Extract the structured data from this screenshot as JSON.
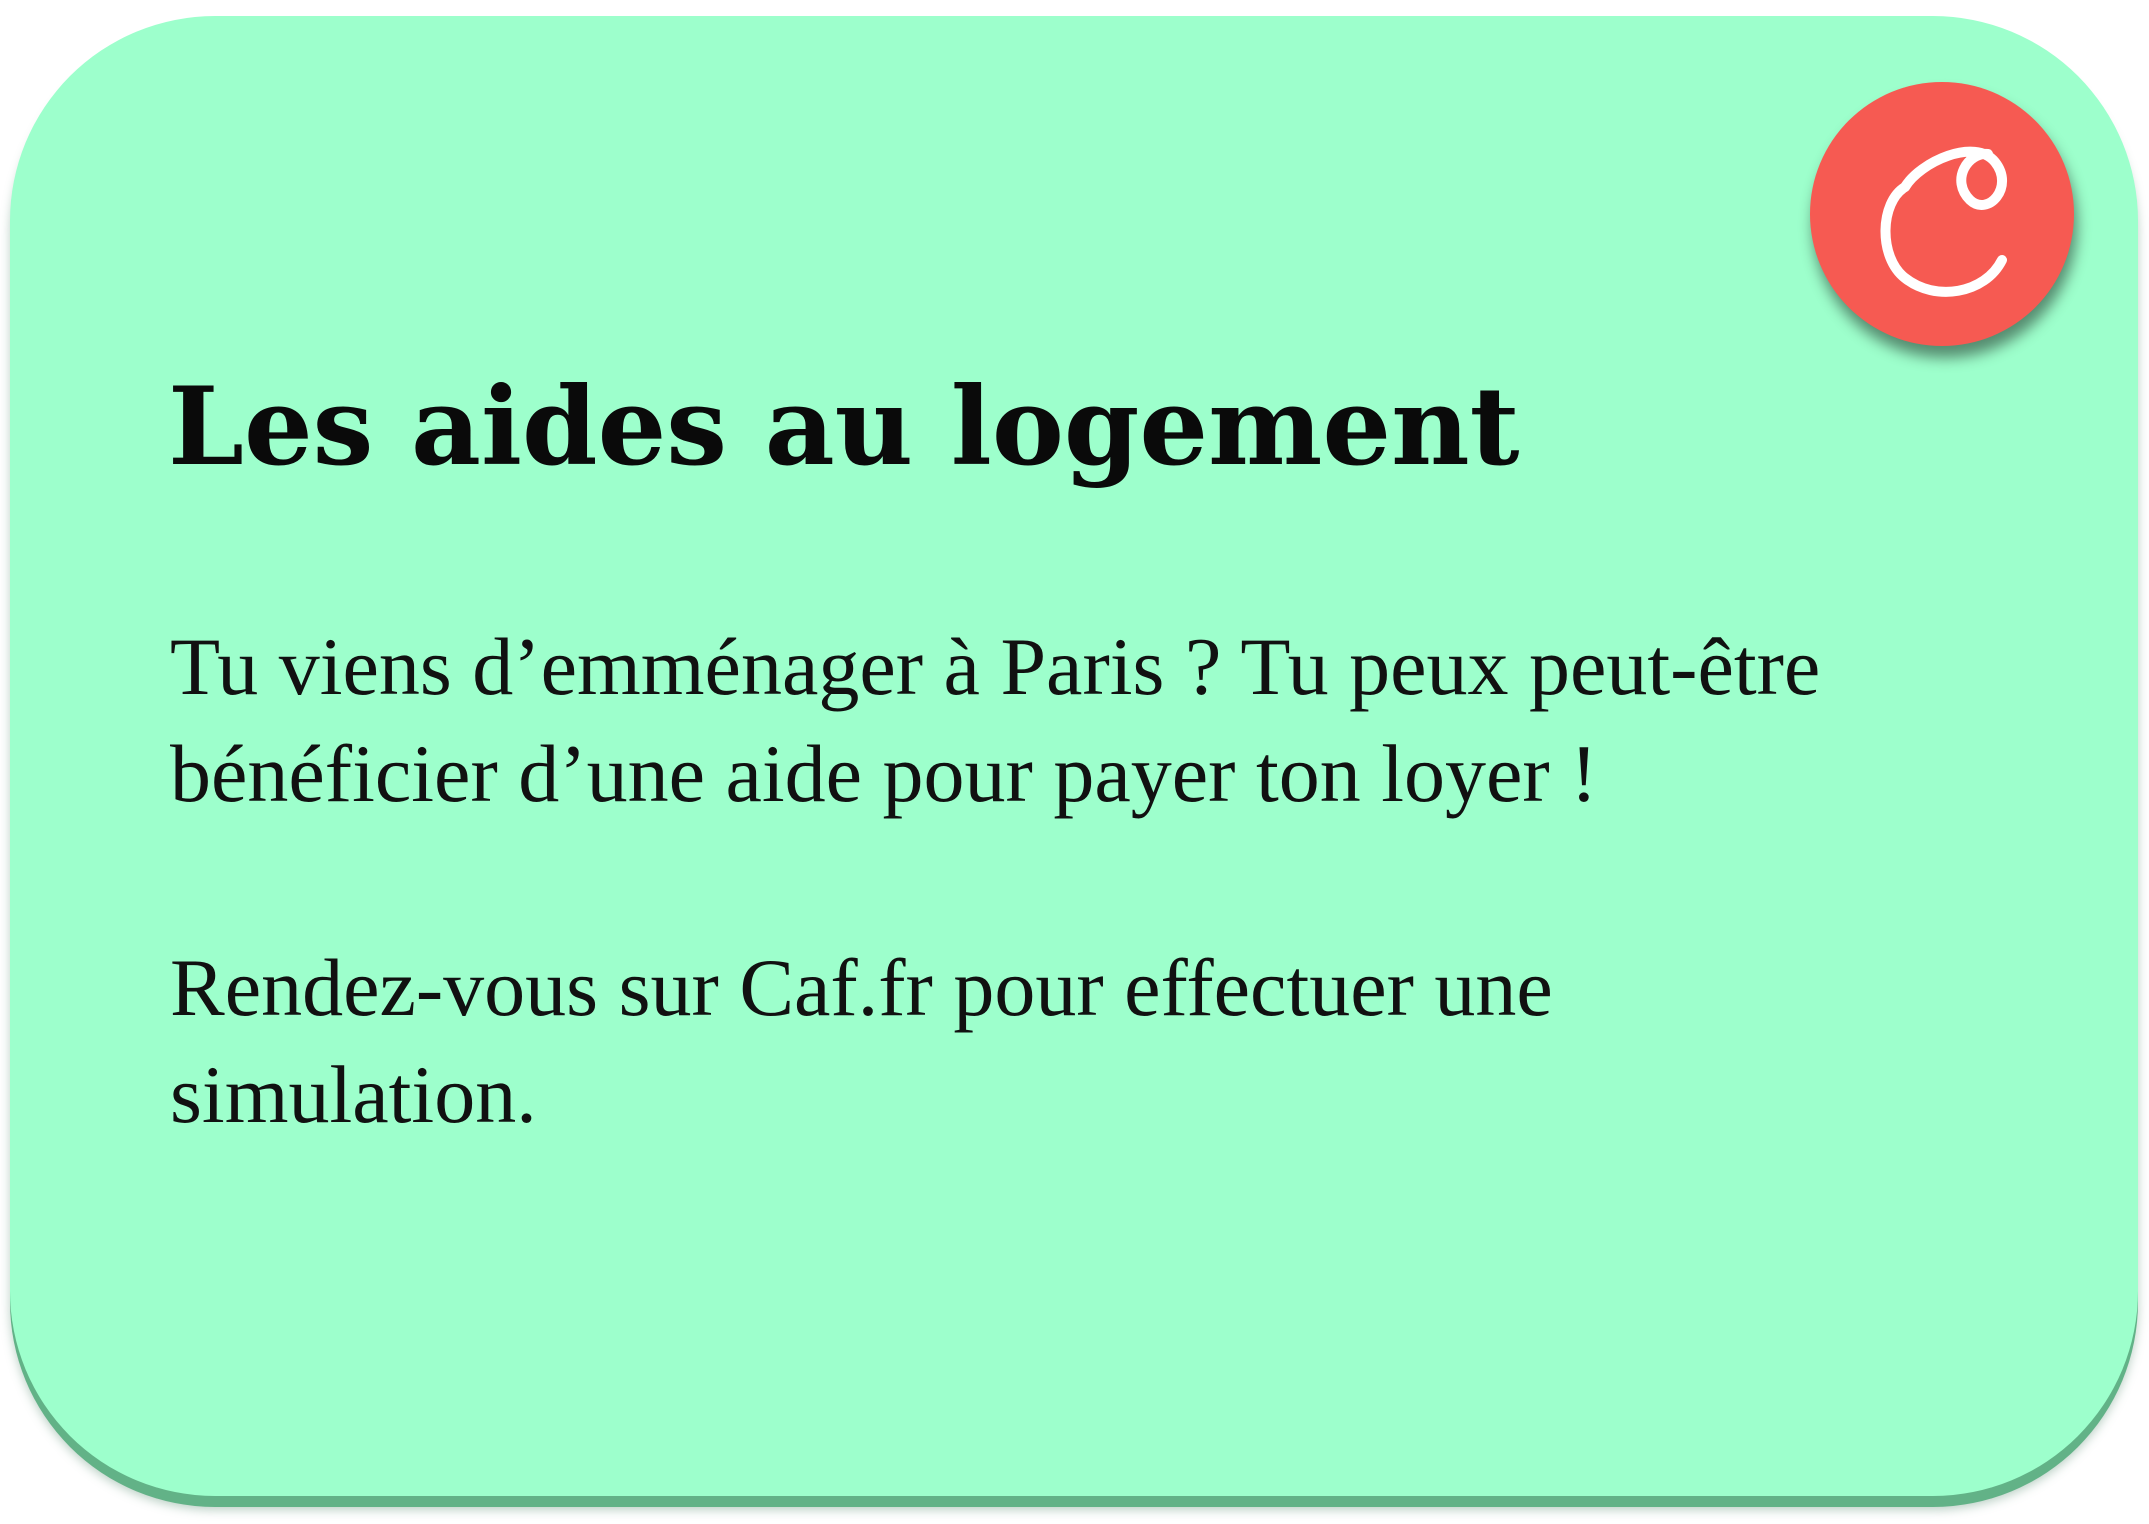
{
  "card": {
    "background_color": "#9dffcc",
    "title": "Les aides au logement",
    "paragraph_1": "Tu viens d’emménager à Paris ? Tu peux peut-être bénéficier d’une aide pour payer ton loyer !",
    "paragraph_2": "Rendez-vous sur Caf.fr pour effectuer une simulation."
  },
  "badge": {
    "icon": "caf-logo-icon",
    "background_color": "#f65a52"
  }
}
